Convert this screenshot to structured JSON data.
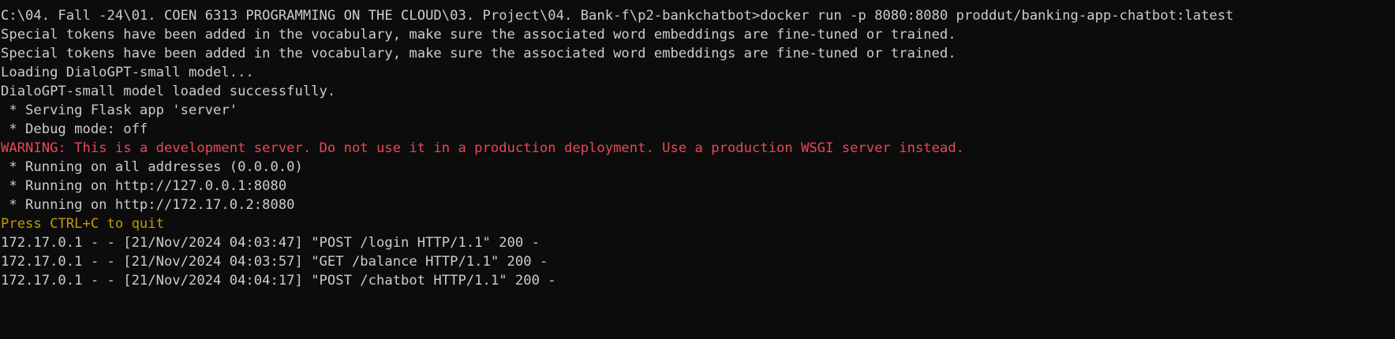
{
  "terminal": {
    "colors": {
      "background": "#0c0c0c",
      "default_text": "#cccccc",
      "warning_text": "#e74856",
      "hint_text": "#c19c00"
    },
    "lines": [
      "C:\\04. Fall -24\\01. COEN 6313 PROGRAMMING ON THE CLOUD\\03. Project\\04. Bank-f\\p2-bankchatbot>docker run -p 8080:8080 proddut/banking-app-chatbot:latest",
      "Special tokens have been added in the vocabulary, make sure the associated word embeddings are fine-tuned or trained.",
      "Special tokens have been added in the vocabulary, make sure the associated word embeddings are fine-tuned or trained.",
      "Loading DialoGPT-small model...",
      "DialoGPT-small model loaded successfully.",
      " * Serving Flask app 'server'",
      " * Debug mode: off",
      "WARNING: This is a development server. Do not use it in a production deployment. Use a production WSGI server instead.",
      " * Running on all addresses (0.0.0.0)",
      " * Running on http://127.0.0.1:8080",
      " * Running on http://172.17.0.2:8080",
      "Press CTRL+C to quit",
      "172.17.0.1 - - [21/Nov/2024 04:03:47] \"POST /login HTTP/1.1\" 200 -",
      "172.17.0.1 - - [21/Nov/2024 04:03:57] \"GET /balance HTTP/1.1\" 200 -",
      "172.17.0.1 - - [21/Nov/2024 04:04:17] \"POST /chatbot HTTP/1.1\" 200 -"
    ]
  }
}
